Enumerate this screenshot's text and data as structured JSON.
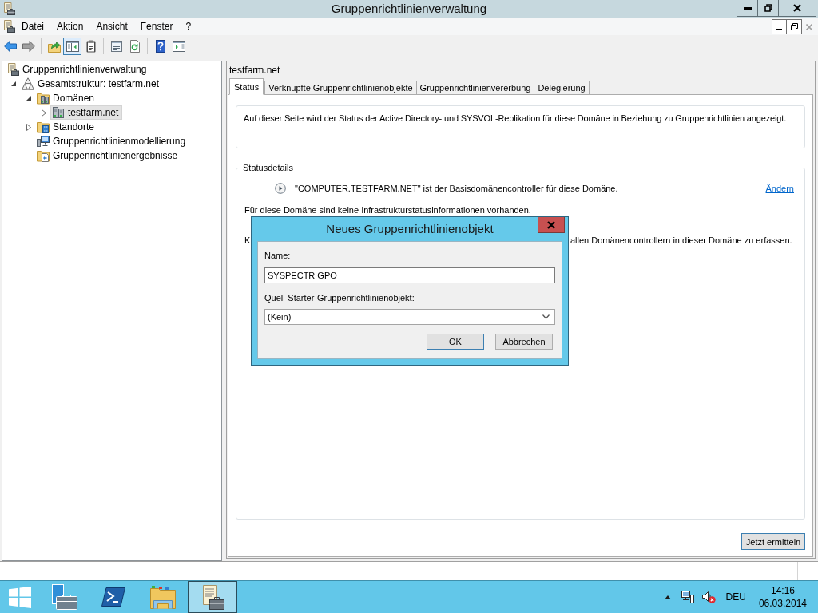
{
  "window": {
    "title": "Gruppenrichtlinienverwaltung"
  },
  "menu": {
    "items": [
      "Datei",
      "Aktion",
      "Ansicht",
      "Fenster",
      "?"
    ],
    "child_controls": [
      {
        "kind": "minimize",
        "disabled": false
      },
      {
        "kind": "restore",
        "disabled": false
      },
      {
        "kind": "close",
        "disabled": true
      }
    ]
  },
  "toolbar": [
    {
      "kind": "back",
      "disabled": false,
      "pressed": false
    },
    {
      "kind": "forward",
      "disabled": true,
      "pressed": false
    },
    {
      "kind": "separator"
    },
    {
      "kind": "up",
      "disabled": false,
      "pressed": false
    },
    {
      "kind": "console_tree",
      "disabled": false,
      "pressed": true
    },
    {
      "kind": "clipboard",
      "disabled": false,
      "pressed": false
    },
    {
      "kind": "separator"
    },
    {
      "kind": "properties",
      "disabled": false,
      "pressed": false
    },
    {
      "kind": "refresh",
      "disabled": false,
      "pressed": false
    },
    {
      "kind": "separator"
    },
    {
      "kind": "help",
      "disabled": false,
      "pressed": false
    },
    {
      "kind": "action_pane",
      "disabled": false,
      "pressed": false
    }
  ],
  "tree": {
    "items": [
      {
        "label": "Gruppenrichtlinienverwaltung",
        "kind": "console",
        "selected": false,
        "children": [
          {
            "label": "Gesamtstruktur: testfarm.net",
            "kind": "forest",
            "expanded": true,
            "selected": false,
            "children": [
              {
                "label": "Domänen",
                "kind": "domains",
                "expanded": true,
                "selected": false,
                "children": [
                  {
                    "label": "testfarm.net",
                    "kind": "domain",
                    "expanded": false,
                    "selected": true
                  }
                ]
              },
              {
                "label": "Standorte",
                "kind": "sites",
                "expanded": false,
                "selected": false
              },
              {
                "label": "Gruppenrichtlinienmodellierung",
                "kind": "modeling",
                "selected": false
              },
              {
                "label": "Gruppenrichtlinienergebnisse",
                "kind": "results",
                "selected": false
              }
            ]
          }
        ]
      }
    ]
  },
  "details": {
    "title": "testfarm.net",
    "tabs": [
      {
        "label": "Status",
        "selected": true
      },
      {
        "label": "Verknüpfte Gruppenrichtlinienobjekte",
        "selected": false
      },
      {
        "label": "Gruppenrichtlinienvererbung",
        "selected": false
      },
      {
        "label": "Delegierung",
        "selected": false
      }
    ],
    "description": "Auf dieser Seite wird der Status der Active Directory- und SYSVOL-Replikation für diese Domäne in Beziehung zu Gruppenrichtlinien angezeigt.",
    "status_group": {
      "title": "Statusdetails",
      "controller_text": "\"COMPUTER.TESTFARM.NET\" ist der Basisdomänencontroller für diese Domäne.",
      "change_link": "Ändern",
      "message": "Für diese Domäne sind keine Infrastrukturstatusinformationen vorhanden.",
      "instruction_start": "K",
      "instruction_end": "allen Domänencontrollern in dieser Domäne zu erfassen."
    },
    "button": "Jetzt ermitteln"
  },
  "dialog": {
    "title": "Neues Gruppenrichtlinienobjekt",
    "fields": [
      {
        "kind": "text",
        "label": "Name:",
        "value": "SYSPECTR GPO"
      },
      {
        "kind": "dropdown",
        "label": "Quell-Starter-Gruppenrichtlinienobjekt:",
        "value": "(Kein)"
      }
    ],
    "buttons": [
      {
        "label": "OK",
        "default": true
      },
      {
        "label": "Abbrechen",
        "default": false
      }
    ]
  },
  "taskbar": {
    "apps": [
      {
        "kind": "server_manager",
        "selected": false
      },
      {
        "kind": "powershell",
        "selected": false
      },
      {
        "kind": "explorer",
        "selected": false
      },
      {
        "kind": "policy_management",
        "selected": true
      }
    ],
    "language": "DEU",
    "time": "14:16",
    "date": "06.03.2014"
  }
}
